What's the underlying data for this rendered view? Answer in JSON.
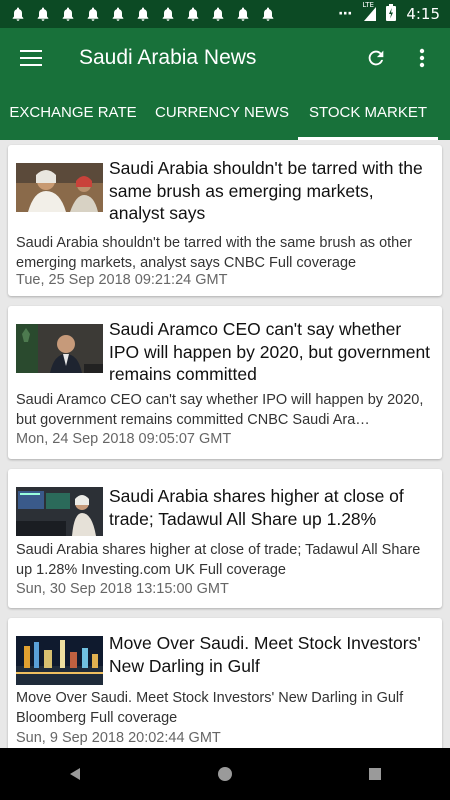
{
  "status_bar": {
    "notification_icons": [
      "bell-icon",
      "bell-icon",
      "bell-icon",
      "bell-icon",
      "bell-icon",
      "bell-icon",
      "bell-icon",
      "bell-icon",
      "bell-icon",
      "bell-icon",
      "bell-icon"
    ],
    "more": "⋯",
    "network": "LTE",
    "time": "4:15"
  },
  "app_bar": {
    "title": "Saudi Arabia News"
  },
  "tabs": [
    {
      "label": "EXCHANGE RATE"
    },
    {
      "label": "CURRENCY NEWS"
    },
    {
      "label": "STOCK MARKET",
      "active": true
    }
  ],
  "articles": [
    {
      "headline": "Saudi Arabia shouldn't be tarred with the same brush as emerging markets, analyst says",
      "summary": "Saudi Arabia shouldn't be tarred with the same brush as other emerging markets, analyst says  CNBC  Full coverage",
      "date": "Tue, 25 Sep 2018 09:21:24 GMT"
    },
    {
      "headline": "Saudi Aramco CEO can't say whether IPO will happen by 2020, but government remains committed",
      "summary": "Saudi Aramco CEO can't say whether IPO will happen by 2020, but government remains committed  CNBC  Saudi Ara…",
      "date": "Mon, 24 Sep 2018 09:05:07 GMT"
    },
    {
      "headline": "Saudi Arabia shares higher at close of trade; Tadawul All Share up 1.28%",
      "summary": "Saudi Arabia shares higher at close of trade; Tadawul All Share up 1.28%  Investing.com UK  Full coverage",
      "date": "Sun, 30 Sep 2018 13:15:00 GMT"
    },
    {
      "headline": "Move Over Saudi. Meet Stock Investors' New Darling in Gulf",
      "summary": "Move Over Saudi. Meet Stock Investors' New Darling in Gulf  Bloomberg  Full coverage",
      "date": "Sun, 9 Sep 2018 20:02:44 GMT"
    }
  ],
  "colors": {
    "status_bar": "#0c4a24",
    "primary": "#18713a",
    "background": "#e8e8e8"
  }
}
